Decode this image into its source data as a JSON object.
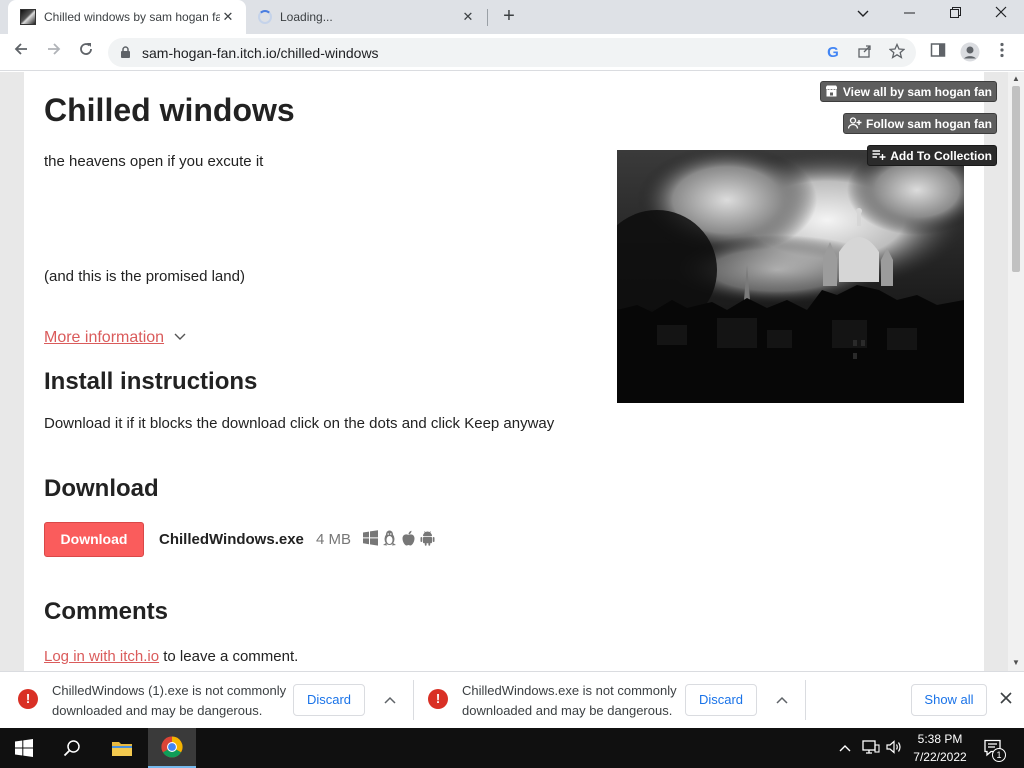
{
  "browser": {
    "tabs": [
      {
        "title": "Chilled windows by sam hogan fan",
        "active": true
      },
      {
        "title": "Loading...",
        "active": false
      }
    ],
    "new_tab_label": "+",
    "url": "sam-hogan-fan.itch.io/chilled-windows",
    "icons": {
      "back": "arrow-left-icon",
      "forward": "arrow-right-icon",
      "reload": "reload-icon",
      "lock": "lock-icon",
      "google": "google-icon",
      "share": "share-icon",
      "bookmark": "star-icon",
      "sidepanel": "side-panel-icon",
      "profile": "profile-icon",
      "menu": "kebab-menu-icon"
    }
  },
  "page": {
    "title": "Chilled windows",
    "description": "the heavens open if you excute it",
    "tagline": "(and this is the promised land)",
    "more_info": "More information",
    "install_heading": "Install instructions",
    "install_text": "Download it if it blocks the download click on the dots and click Keep anyway",
    "download_heading": "Download",
    "download_button": "Download",
    "file_name": "ChilledWindows.exe",
    "file_size": "4 MB",
    "platforms": [
      "windows-icon",
      "linux-icon",
      "apple-icon",
      "android-icon"
    ],
    "comments_heading": "Comments",
    "login_link": "Log in with itch.io",
    "login_suffix": " to leave a comment.",
    "top_buttons": {
      "view_all": "View all by sam hogan fan",
      "follow": "Follow sam hogan fan",
      "add_collection": "Add To Collection"
    }
  },
  "download_bar": {
    "items": [
      {
        "line1": "ChilledWindows (1).exe is not commonly",
        "line2": "downloaded and may be dangerous.",
        "action": "Discard"
      },
      {
        "line1": "ChilledWindows.exe is not commonly",
        "line2": "downloaded and may be dangerous.",
        "action": "Discard"
      }
    ],
    "show_all": "Show all"
  },
  "taskbar": {
    "time": "5:38 PM",
    "date": "7/22/2022",
    "notification_count": "1"
  },
  "colors": {
    "itch_red": "#fa5c5c",
    "link_red": "#da5b5b",
    "danger": "#d93025",
    "chrome_blue": "#1a73e8"
  }
}
